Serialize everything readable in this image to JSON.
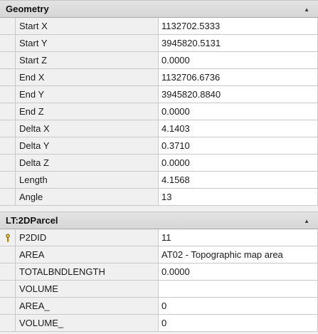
{
  "sections": [
    {
      "title": "Geometry",
      "rows": [
        {
          "label": "Start X",
          "value": "1132702.5333"
        },
        {
          "label": "Start Y",
          "value": "3945820.5131"
        },
        {
          "label": "Start Z",
          "value": "0.0000"
        },
        {
          "label": "End X",
          "value": "1132706.6736"
        },
        {
          "label": "End Y",
          "value": "3945820.8840"
        },
        {
          "label": "End Z",
          "value": "0.0000"
        },
        {
          "label": "Delta X",
          "value": "4.1403"
        },
        {
          "label": "Delta Y",
          "value": "0.3710"
        },
        {
          "label": "Delta Z",
          "value": "0.0000"
        },
        {
          "label": "Length",
          "value": "4.1568"
        },
        {
          "label": "Angle",
          "value": "13"
        }
      ]
    },
    {
      "title": "LT:2DParcel",
      "rows": [
        {
          "label": "P2DID",
          "value": "11",
          "icon": "key-icon"
        },
        {
          "label": "AREA",
          "value": "AT02 - Topographic map area"
        },
        {
          "label": "TOTALBNDLENGTH",
          "value": "0.0000"
        },
        {
          "label": "VOLUME",
          "value": ""
        },
        {
          "label": "AREA_",
          "value": "0"
        },
        {
          "label": "VOLUME_",
          "value": "0"
        }
      ]
    }
  ],
  "icons": {
    "collapse": "chevron-up-icon"
  }
}
